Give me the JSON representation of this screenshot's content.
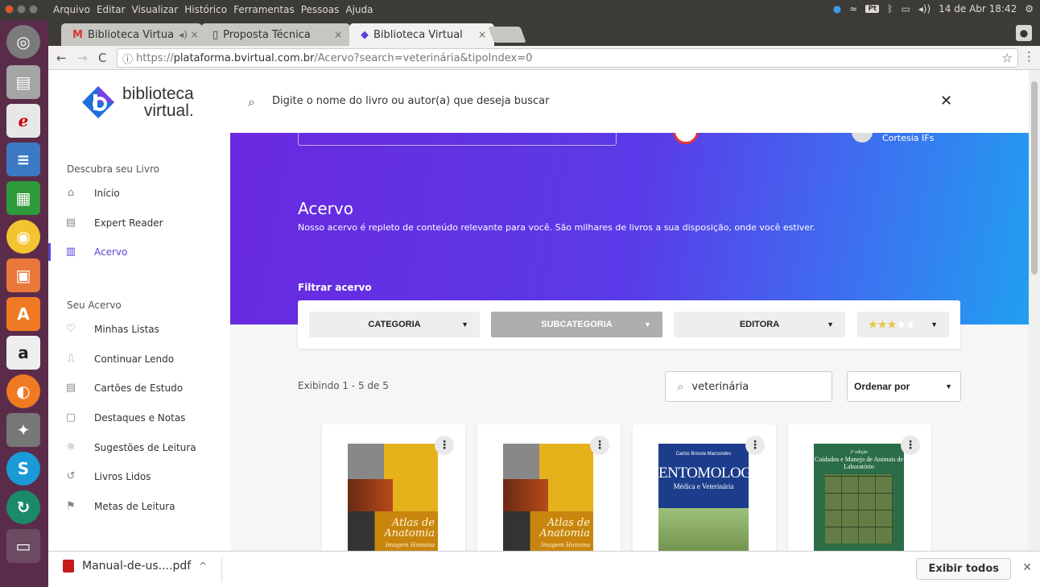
{
  "system": {
    "menus": [
      "Arquivo",
      "Editar",
      "Visualizar",
      "Histórico",
      "Ferramentas",
      "Pessoas",
      "Ajuda"
    ],
    "tray_lang": "Pt",
    "clock": "14 de Abr 18:42"
  },
  "tabs": [
    {
      "label": "Biblioteca Virtua",
      "icon": "gmail-icon"
    },
    {
      "label": "Proposta Técnica",
      "icon": "doc-icon"
    },
    {
      "label": "Biblioteca Virtual",
      "icon": "bv-icon"
    }
  ],
  "address": {
    "host_prefix": "https://",
    "host": "plataforma.bvirtual.com.br",
    "path": "/Acervo?search=veterinária&tipoIndex=0"
  },
  "logo": {
    "line1": "biblioteca",
    "line2": "virtual."
  },
  "search_header": {
    "placeholder": "Digite o nome do livro ou autor(a) que deseja buscar"
  },
  "sidebar": {
    "section1": "Descubra seu Livro",
    "items1": [
      {
        "label": "Início",
        "icon": "home-icon"
      },
      {
        "label": "Expert Reader",
        "icon": "reader-icon"
      },
      {
        "label": "Acervo",
        "icon": "library-icon"
      }
    ],
    "section2": "Seu Acervo",
    "items2": [
      {
        "label": "Minhas Listas",
        "icon": "heart-icon"
      },
      {
        "label": "Continuar Lendo",
        "icon": "bookmark-icon"
      },
      {
        "label": "Cartões de Estudo",
        "icon": "card-icon"
      },
      {
        "label": "Destaques e Notas",
        "icon": "note-icon"
      },
      {
        "label": "Sugestões de Leitura",
        "icon": "bulb-icon"
      },
      {
        "label": "Livros Lidos",
        "icon": "history-icon"
      },
      {
        "label": "Metas de Leitura",
        "icon": "goal-icon"
      }
    ]
  },
  "hero": {
    "cortesia": "Cortesia IFs",
    "title": "Acervo",
    "subtitle": "Nosso acervo é repleto de conteúdo relevante para você. São milhares de livros a sua disposição, onde você estiver.",
    "filter_label": "Filtrar acervo"
  },
  "filters": {
    "categoria": "CATEGORIA",
    "subcategoria": "SUBCATEGORIA",
    "editora": "EDITORA",
    "rating": "★★★",
    "rating_off": "★★"
  },
  "results": {
    "count_text": "Exibindo 1 - 5 de 5",
    "search_value": "veterinária",
    "sort_label": "Ordenar por"
  },
  "books": [
    {
      "cover_title": "Atlas de Anatomia",
      "cover_sub": "Imagem Humana"
    },
    {
      "cover_title": "Atlas de Anatomia",
      "cover_sub": "Imagem Humana"
    },
    {
      "author": "Carlos Brisola Marcondes",
      "cover_title": "ENTOMOLOGIA",
      "cover_sub": "Médica e Veterinária"
    },
    {
      "edition": "2ª edição",
      "cover_title": "Cuidados e Manejo de Animais de Laboratório"
    }
  ],
  "downloads": {
    "file": "Manual-de-us....pdf",
    "show_all": "Exibir todos"
  }
}
